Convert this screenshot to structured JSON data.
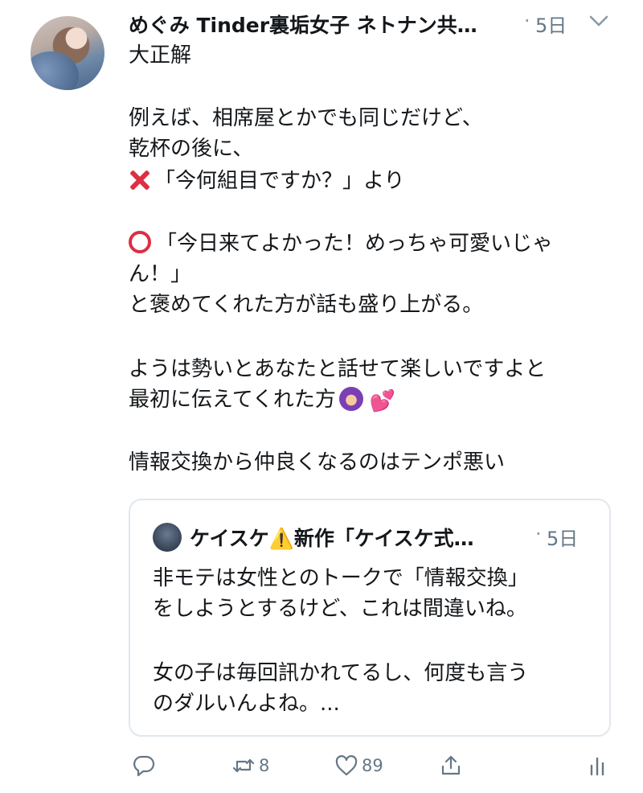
{
  "tweet": {
    "author": "めぐみ Tinder裏垢女子 ネトナン共…",
    "dot": "·",
    "time": "5日",
    "lines": [
      "大正解",
      "例えば、相席屋とかでも同じだけど、",
      "乾杯の後に、",
      "「今何組目ですか？」より",
      "「今日来てよかった！めっちゃ可愛いじゃ",
      "ん！」",
      "と褒めてくれた方が話も盛り上がる。",
      "ようは勢いとあなたと話せて楽しいですよと",
      "最初に伝えてくれた方",
      "情報交換から仲良くなるのはテンポ悪い"
    ]
  },
  "quote": {
    "author": "ケイスケ⚠️新作「ケイスケ式…",
    "dot": "·",
    "time": "5日",
    "lines": [
      "非モテは女性とのトークで「情報交換」",
      "をしようとするけど、これは間違いね。",
      "女の子は毎回訊かれてるし、何度も言う",
      "のダルいんよね。..."
    ]
  },
  "actions": {
    "reply_icon": "reply-icon",
    "retweet_count": "8",
    "like_count": "89",
    "share_icon": "share-icon",
    "analytics_icon": "analytics-icon"
  },
  "colors": {
    "text": "#14171a",
    "secondary": "#657786",
    "border": "#e1e8ed",
    "emoji_red": "#dd2e44"
  }
}
